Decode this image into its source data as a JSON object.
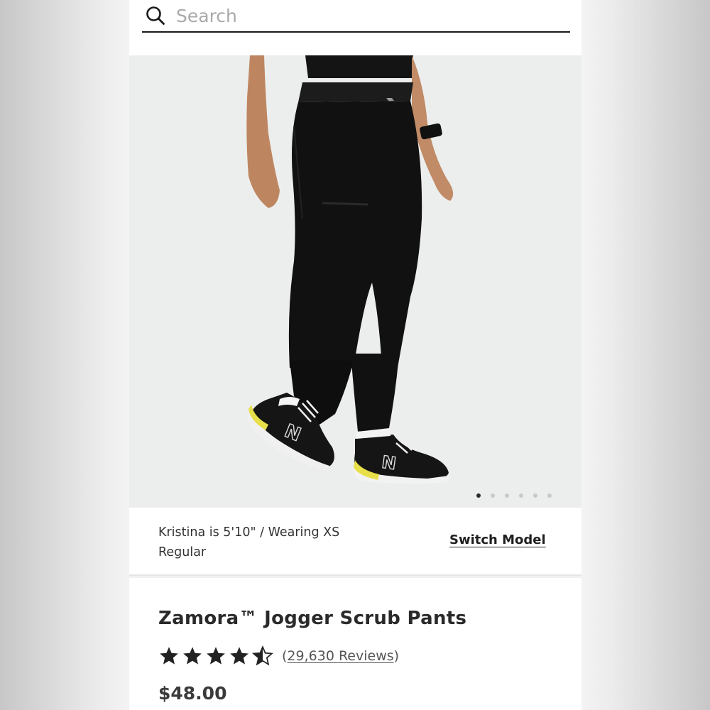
{
  "search": {
    "placeholder": "Search",
    "icon": "search-icon"
  },
  "gallery": {
    "image_alt": "Model wearing black jogger scrub pants with black sneakers",
    "slide_count": 6,
    "active_slide": 1
  },
  "model": {
    "description": "Kristina is 5'10\" / Wearing XS Regular",
    "switch_label": "Switch Model"
  },
  "product": {
    "name": "Zamora™ Jogger Scrub Pants",
    "rating": 4.5,
    "rating_max": 5,
    "reviews_open": "(",
    "reviews_text": "29,630 Reviews",
    "reviews_close": ")",
    "price": "$48.00"
  },
  "colors": {
    "text_dark": "#2a2a2a",
    "background": "#ffffff",
    "hero_bg": "#eceeed"
  }
}
